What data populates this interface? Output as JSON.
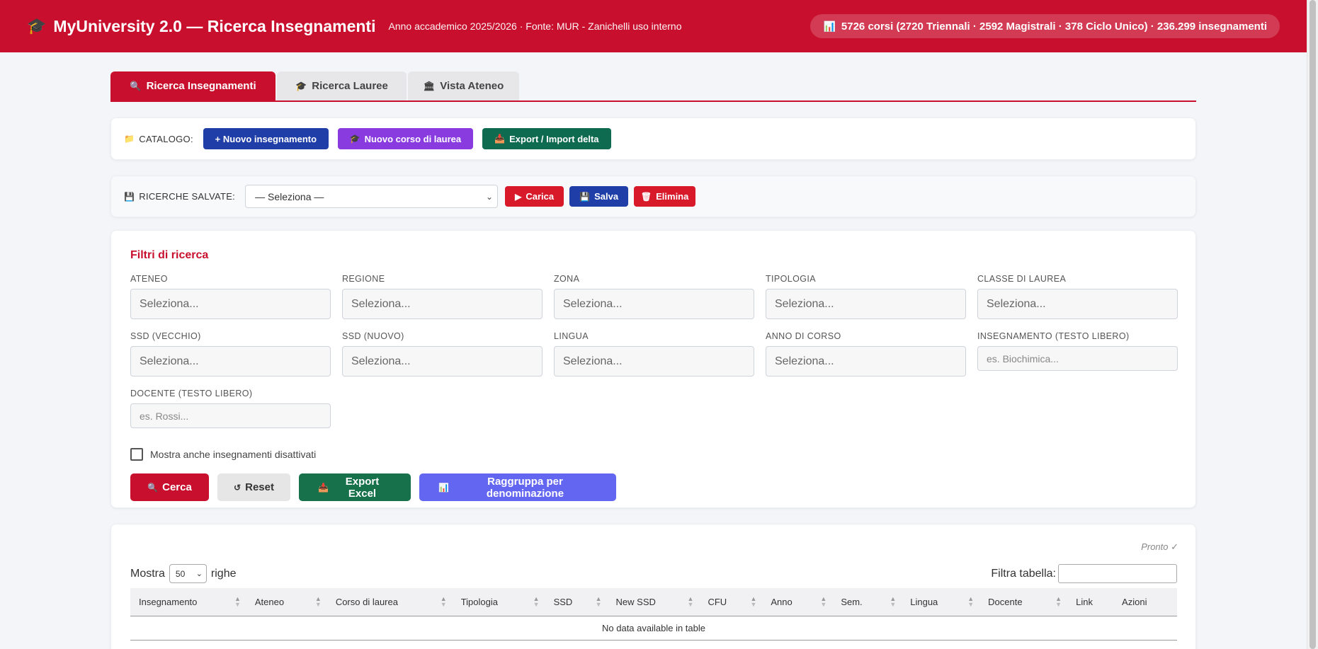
{
  "header": {
    "logo_icon": "graduation-cap-icon",
    "logo_glyph": "🎓",
    "title": "MyUniversity 2.0 — Ricerca Insegnamenti",
    "subtitle": "Anno accademico 2025/2026 · Fonte: MUR - Zanichelli uso interno",
    "stats_icon": "📊",
    "stats": "5726 corsi (2720 Triennali · 2592 Magistrali · 378 Ciclo Unico) · 236.299 insegnamenti",
    "brand_color": "#c8102e"
  },
  "tabs": [
    {
      "icon": "🔍",
      "label": "Ricerca Insegnamenti",
      "active": true
    },
    {
      "icon": "🎓",
      "label": "Ricerca Lauree",
      "active": false
    },
    {
      "icon": "🏛",
      "label": "Vista Ateneo",
      "active": false
    }
  ],
  "catalog": {
    "icon": "📁",
    "label": "CATALOGO:",
    "buttons": [
      {
        "label": "+ Nuovo insegnamento",
        "icon": ""
      },
      {
        "label": "Nuovo corso di laurea",
        "icon": "🎓"
      },
      {
        "label": "Export / Import delta",
        "icon": "📥"
      }
    ]
  },
  "saved_searches": {
    "icon": "💾",
    "label": "RICERCHE SALVATE:",
    "selected": "— Seleziona —",
    "load": {
      "icon": "▶",
      "label": "Carica"
    },
    "save": {
      "icon": "💾",
      "label": "Salva"
    },
    "delete": {
      "icon": "🗑",
      "label": "Elimina"
    }
  },
  "filters": {
    "title": "Filtri di ricerca",
    "fields": [
      {
        "label": "ATENEO",
        "placeholder": "Seleziona..."
      },
      {
        "label": "REGIONE",
        "placeholder": "Seleziona..."
      },
      {
        "label": "ZONA",
        "placeholder": "Seleziona..."
      },
      {
        "label": "TIPOLOGIA",
        "placeholder": "Seleziona..."
      },
      {
        "label": "CLASSE DI LAUREA",
        "placeholder": "Seleziona..."
      },
      {
        "label": "SSD (VECCHIO)",
        "placeholder": "Seleziona..."
      },
      {
        "label": "SSD (NUOVO)",
        "placeholder": "Seleziona..."
      },
      {
        "label": "LINGUA",
        "placeholder": "Seleziona..."
      },
      {
        "label": "ANNO DI CORSO",
        "placeholder": "Seleziona..."
      },
      {
        "label": "INSEGNAMENTO (TESTO LIBERO)",
        "placeholder": "es. Biochimica..."
      },
      {
        "label": "DOCENTE (TESTO LIBERO)",
        "placeholder": "es. Rossi..."
      }
    ],
    "show_disabled_label": "Mostra anche insegnamenti disattivati",
    "show_disabled_checked": false,
    "buttons": {
      "search": {
        "icon": "🔍",
        "label": "Cerca"
      },
      "reset": {
        "icon": "↺",
        "label": "Reset"
      },
      "export": {
        "icon": "📥",
        "label": "Export Excel"
      },
      "group": {
        "icon": "📊",
        "label": "Raggruppa per denominazione"
      }
    }
  },
  "results": {
    "status": "Pronto ✓",
    "show_prefix": "Mostra",
    "page_length": "50",
    "show_suffix": "righe",
    "filter_label": "Filtra tabella:",
    "columns": [
      "Insegnamento",
      "Ateneo",
      "Corso di laurea",
      "Tipologia",
      "SSD",
      "New SSD",
      "CFU",
      "Anno",
      "Sem.",
      "Lingua",
      "Docente",
      "Link",
      "Azioni"
    ],
    "empty_message": "No data available in table"
  }
}
